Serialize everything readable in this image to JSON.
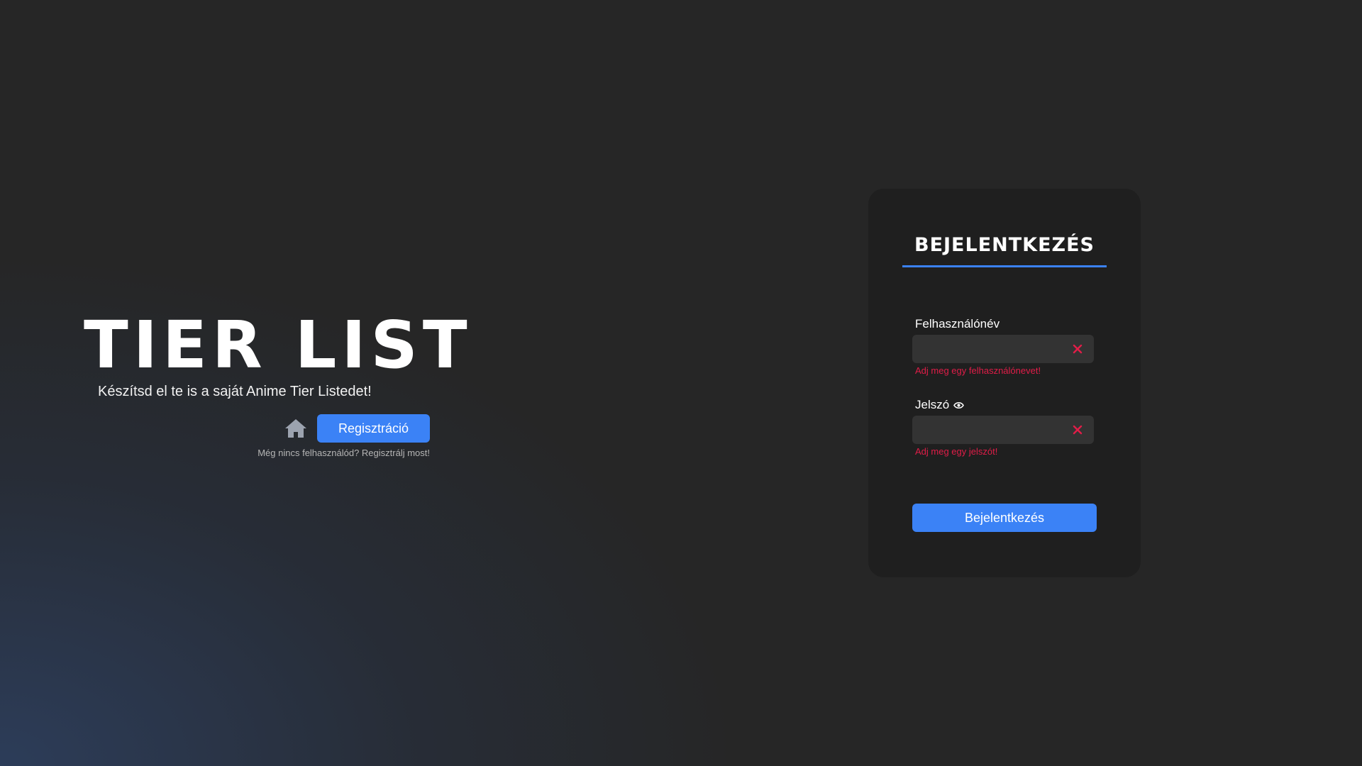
{
  "hero": {
    "title": "TIER LIST",
    "subtitle": "Készítsd el te is a saját Anime Tier Listedet!",
    "home_icon": "home-icon",
    "register_button": "Regisztráció",
    "register_hint": "Még nincs felhasználód? Regisztrálj most!"
  },
  "login": {
    "title": "BEJELENTKEZÉS",
    "username": {
      "label": "Felhasználónév",
      "value": "",
      "error": "Adj meg egy felhasználónevet!"
    },
    "password": {
      "label": "Jelszó",
      "value": "",
      "error": "Adj meg egy jelszót!",
      "visibility_icon": "eye-icon"
    },
    "submit_button": "Bejelentkezés"
  },
  "colors": {
    "accent": "#3b82f6",
    "error": "#e11d48",
    "card_background": "#1f1f1f",
    "page_background": "#262626"
  }
}
